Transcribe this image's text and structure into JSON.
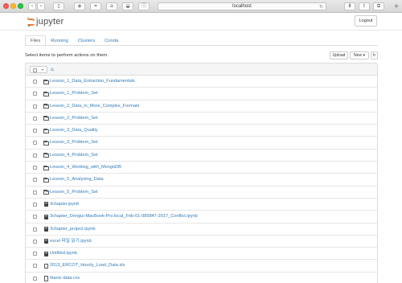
{
  "browser": {
    "url": "localhost",
    "reload_glyph": "↻"
  },
  "header": {
    "logo_text": "jupyter",
    "logout_label": "Logout"
  },
  "tabs": [
    {
      "label": "Files",
      "active": true
    },
    {
      "label": "Running",
      "active": false
    },
    {
      "label": "Clusters",
      "active": false
    },
    {
      "label": "Conda",
      "active": false
    }
  ],
  "instructions": "Select items to perform actions on them.",
  "toolbar": {
    "upload_label": "Upload",
    "new_label": "New ▾",
    "refresh_glyph": "↻"
  },
  "list": {
    "header": {
      "caret_glyph": "▾",
      "home_glyph": "⌂"
    },
    "items": [
      {
        "type": "folder",
        "name": "Lesson_1_Data_Extraction_Fundamentals"
      },
      {
        "type": "folder",
        "name": "Lesson_1_Problem_Set"
      },
      {
        "type": "folder",
        "name": "Lesson_2_Data_in_More_Complex_Formats"
      },
      {
        "type": "folder",
        "name": "Lesson_2_Problem_Set"
      },
      {
        "type": "folder",
        "name": "Lesson_3_Data_Quality"
      },
      {
        "type": "folder",
        "name": "Lesson_3_Problem_Set"
      },
      {
        "type": "folder",
        "name": "Lesson_4_Problem_Set"
      },
      {
        "type": "folder",
        "name": "Lesson_4_Working_with_MongoDB"
      },
      {
        "type": "folder",
        "name": "Lesson_5_Analyzing_Data"
      },
      {
        "type": "folder",
        "name": "Lesson_5_Problem_Set"
      },
      {
        "type": "notebook",
        "name": "3chapter.ipynb"
      },
      {
        "type": "notebook",
        "name": "3chapter_Dongui-MacBook-Pro.local_Feb-01-085847-2017_Conflict.ipynb"
      },
      {
        "type": "notebook",
        "name": "3chapter_project.ipynb"
      },
      {
        "type": "notebook",
        "name": "excel 파일 읽기.ipynb"
      },
      {
        "type": "notebook",
        "name": "Untitled.ipynb"
      },
      {
        "type": "file",
        "name": "2013_ERCOT_Hourly_Load_Data.xls"
      },
      {
        "type": "file",
        "name": "titanic-data.csv"
      }
    ]
  },
  "colors": {
    "link": "#337ab7",
    "jupyter_orange": "#f37726"
  }
}
